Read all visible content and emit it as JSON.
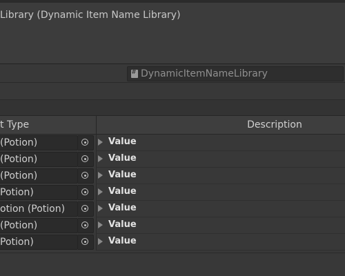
{
  "header": {
    "title": "Library (Dynamic Item Name Library)"
  },
  "script_field": {
    "value": "DynamicItemNameLibrary",
    "icon": "csharp-script-icon"
  },
  "table": {
    "columns": [
      "t Type",
      "Description"
    ],
    "rows": [
      {
        "object": "(Potion)",
        "description": "Value"
      },
      {
        "object": "(Potion)",
        "description": "Value"
      },
      {
        "object": "(Potion)",
        "description": "Value"
      },
      {
        "object": "Potion)",
        "description": "Value"
      },
      {
        "object": "otion (Potion)",
        "description": "Value"
      },
      {
        "object": "(Potion)",
        "description": "Value"
      },
      {
        "object": "Potion)",
        "description": "Value"
      }
    ]
  }
}
